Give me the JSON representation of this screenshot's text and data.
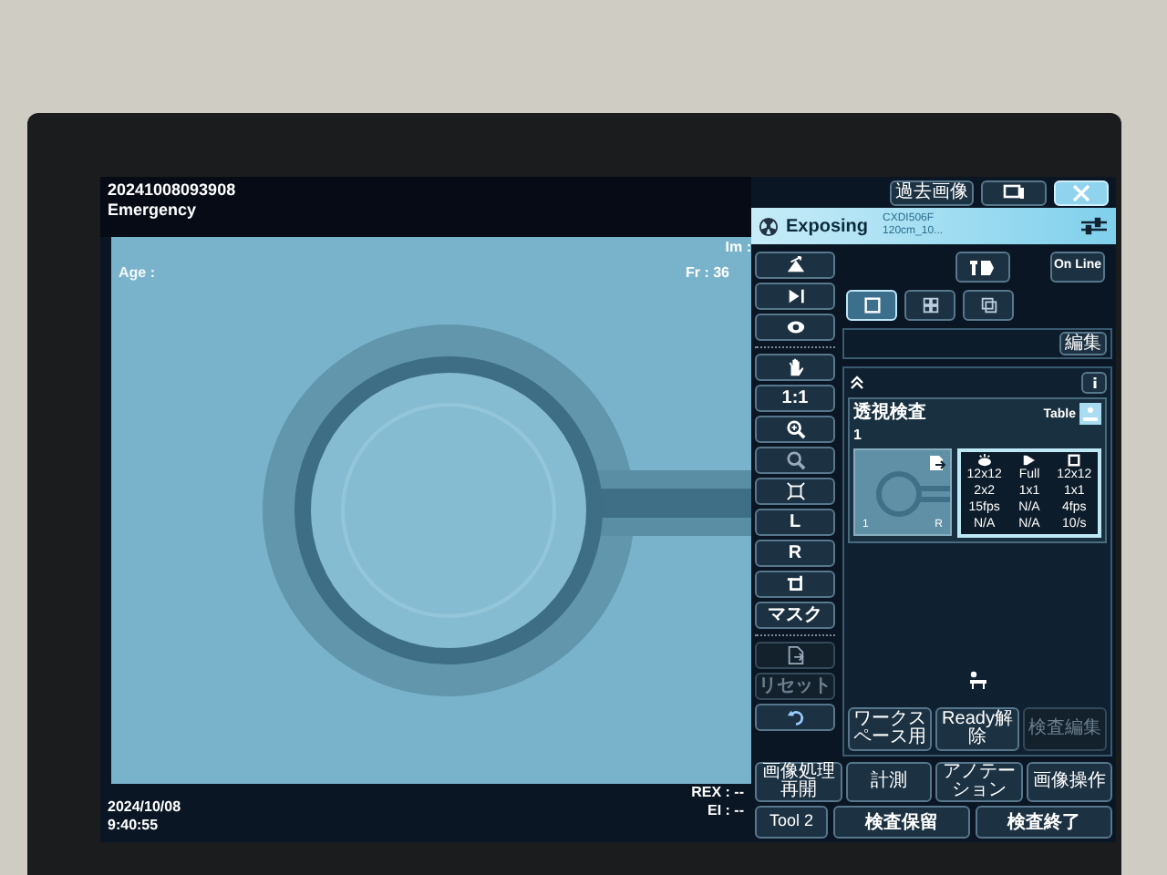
{
  "case": {
    "id": "20241008093908",
    "priority": "Emergency"
  },
  "image_overlay": {
    "im": "Im :",
    "age": "Age :",
    "frame": "Fr : 36"
  },
  "footer": {
    "date": "2024/10/08",
    "time": "9:40:55",
    "rex": "REX : --",
    "ei": "EI : --"
  },
  "top_buttons": [
    {
      "kind": "text",
      "label": "過去画像"
    },
    {
      "kind": "icon"
    },
    {
      "kind": "close"
    }
  ],
  "status": {
    "state": "Exposing",
    "detector": "CXDI506F",
    "distance": "120cm_10..."
  },
  "online": "On Line",
  "layouts": [
    {
      "selected": true
    },
    {
      "selected": false
    },
    {
      "selected": false
    }
  ],
  "edit": "編集",
  "protocol": {
    "name": "透視検査",
    "number": "1",
    "position": "Table",
    "thumb_number": "1",
    "thumb_side": "R",
    "params": [
      [
        "12x12",
        "Full",
        "12x12"
      ],
      [
        "2x2",
        "1x1",
        "1x1"
      ],
      [
        "15fps",
        "N/A",
        "4fps"
      ],
      [
        "N/A",
        "N/A",
        "10/s"
      ]
    ]
  },
  "tools": [
    {
      "kind": "icon",
      "disabled": false
    },
    {
      "kind": "icon",
      "disabled": false
    },
    {
      "kind": "icon",
      "disabled": false
    },
    {
      "kind": "icon",
      "disabled": false
    },
    {
      "kind": "text",
      "label": "1:1",
      "disabled": false
    },
    {
      "kind": "icon",
      "disabled": false
    },
    {
      "kind": "icon",
      "disabled": false
    },
    {
      "kind": "icon",
      "disabled": false
    },
    {
      "kind": "text",
      "label": "L",
      "disabled": false
    },
    {
      "kind": "text",
      "label": "R",
      "disabled": false
    },
    {
      "kind": "icon",
      "disabled": false
    },
    {
      "kind": "text",
      "label": "マスク",
      "disabled": false
    },
    {
      "kind": "icon",
      "disabled": true
    },
    {
      "kind": "text",
      "label": "リセット",
      "disabled": true
    },
    {
      "kind": "icon",
      "disabled": false
    }
  ],
  "workspace_buttons": [
    {
      "label": "ワークスペース用",
      "disabled": false
    },
    {
      "label": "Ready解除",
      "disabled": false
    },
    {
      "label": "検査編集",
      "disabled": true
    }
  ],
  "action_buttons": [
    "画像処理再開",
    "計測",
    "アノテーション",
    "画像操作"
  ],
  "bottom": {
    "tool": "Tool 2",
    "hold": "検査保留",
    "end": "検査終了"
  }
}
